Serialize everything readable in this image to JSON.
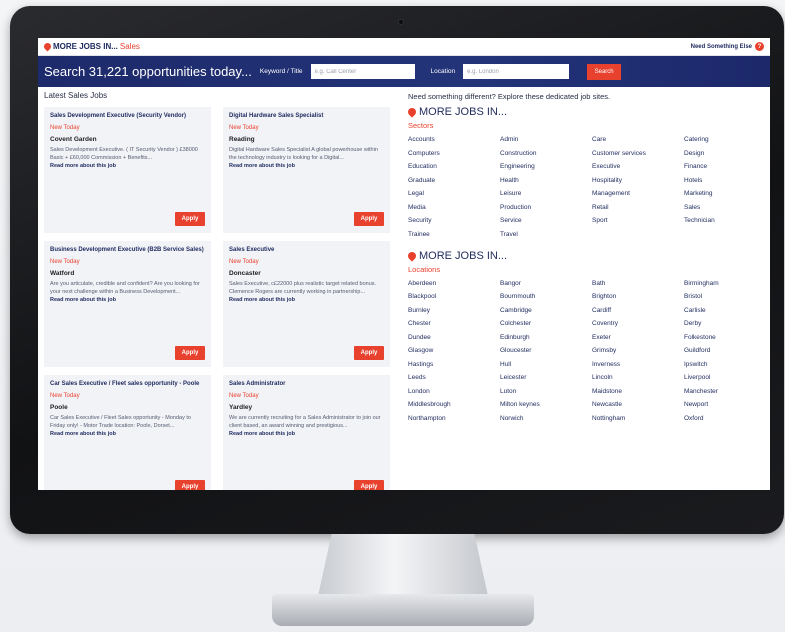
{
  "topbar": {
    "brand": "MORE JOBS IN...",
    "brand_accent": "Sales",
    "need_text": "Need Something Else",
    "help_glyph": "?"
  },
  "search": {
    "title": "Search 31,221 opportunities today...",
    "keyword_label": "Keyword / Title",
    "keyword_placeholder": "e.g. Call Center",
    "location_label": "Location",
    "location_placeholder": "e.g. London",
    "button": "Search"
  },
  "latest": {
    "heading": "Latest Sales Jobs",
    "jobs": [
      {
        "title": "Sales Development Executive (Security Vendor)",
        "badge": "New Today",
        "location": "Covent Garden",
        "desc": "Sales Development Executive. ( IT Security Vendor ) £38000 Basic + £60,000 Commission + Benefits...",
        "more": "Read more about this job",
        "apply": "Apply"
      },
      {
        "title": "Digital Hardware Sales Specialist",
        "badge": "New Today",
        "location": "Reading",
        "desc": "Digital Hardware Sales Specialist A global powerhouse within the technology industry is looking for a Digital...",
        "more": "Read more about this job",
        "apply": "Apply"
      },
      {
        "title": "Business Development Executive (B2B Service Sales)",
        "badge": "New Today",
        "location": "Watford",
        "desc": "Are you articulate, credible and confident? Are you looking for your next challenge within a Business Development...",
        "more": "Read more about this job",
        "apply": "Apply"
      },
      {
        "title": "Sales Executive",
        "badge": "New Today",
        "location": "Doncaster",
        "desc": "Sales Executive, c£22000 plus realistic target related bonus. Clemence Rogers are currently working in partnership...",
        "more": "Read more about this job",
        "apply": "Apply"
      },
      {
        "title": "Car Sales Executive / Fleet sales opportunity - Poole",
        "badge": "New Today",
        "location": "Poole",
        "desc": "Car Sales Executive / Fleet Sales opportunity - Monday to Friday only! - Motor Trade location: Poole, Dorset...",
        "more": "Read more about this job",
        "apply": "Apply"
      },
      {
        "title": "Sales Administrator",
        "badge": "New Today",
        "location": "Yardley",
        "desc": "We are currently recruiting for a Sales Administrator to join our client based, an award winning and prestigious...",
        "more": "Read more about this job",
        "apply": "Apply"
      }
    ]
  },
  "dedicated": "Need something different? Explore these dedicated job sites.",
  "sectors": {
    "heading": "MORE JOBS IN...",
    "sub": "Sectors",
    "items": [
      "Accounts",
      "Admin",
      "Care",
      "Catering",
      "Computers",
      "Construction",
      "Customer services",
      "Design",
      "Education",
      "Engineering",
      "Executive",
      "Finance",
      "Graduate",
      "Health",
      "Hospitality",
      "Hotels",
      "Legal",
      "Leisure",
      "Management",
      "Marketing",
      "Media",
      "Production",
      "Retail",
      "Sales",
      "Security",
      "Service",
      "Sport",
      "Technician",
      "Trainee",
      "Travel"
    ]
  },
  "locations": {
    "heading": "MORE JOBS IN...",
    "sub": "Locations",
    "items": [
      "Aberdeen",
      "Bangor",
      "Bath",
      "Birmingham",
      "Blackpool",
      "Bournmouth",
      "Brighton",
      "Bristol",
      "Burnley",
      "Cambridge",
      "Cardiff",
      "Carlisle",
      "Chester",
      "Colchester",
      "Coventry",
      "Derby",
      "Dundee",
      "Edinburgh",
      "Exeter",
      "Folkestone",
      "Glasgow",
      "Gloucester",
      "Grimsby",
      "Guildford",
      "Hastings",
      "Hull",
      "Inverness",
      "Ipswitch",
      "Leeds",
      "Leicester",
      "Lincoln",
      "Liverpool",
      "London",
      "Luton",
      "Maidstone",
      "Manchester",
      "Middlesbrough",
      "Milton keynes",
      "Newcastle",
      "Newport",
      "Northampton",
      "Norwich",
      "Nottingham",
      "Oxford"
    ]
  },
  "colors": {
    "navy": "#1e2a5e",
    "accent": "#e8412e",
    "card_bg": "#f2f3f7"
  }
}
